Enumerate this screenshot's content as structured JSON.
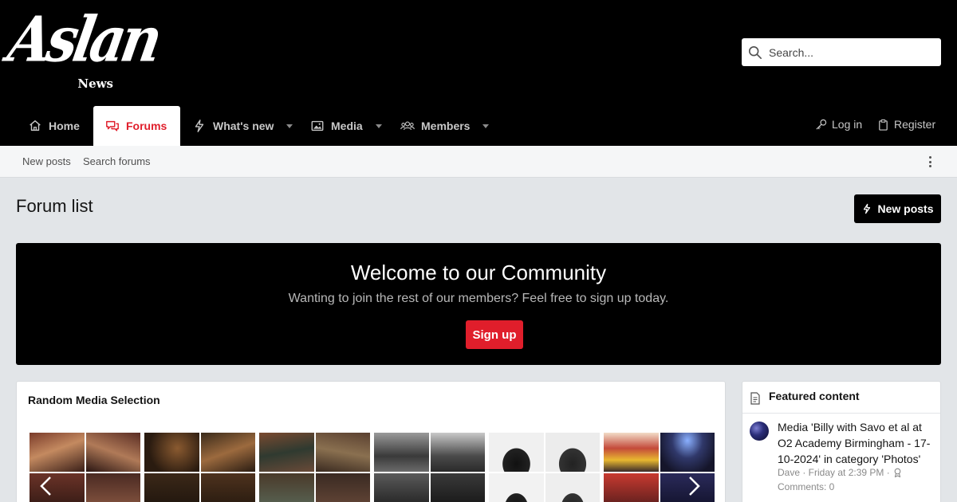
{
  "logo": {
    "script": "Aslan",
    "sub": "News"
  },
  "search": {
    "placeholder": "Search..."
  },
  "nav": {
    "tabs": [
      {
        "label": "Home",
        "icon": "home-icon"
      },
      {
        "label": "Forums",
        "icon": "chat-icon",
        "active": true
      },
      {
        "label": "What's new",
        "icon": "bolt-icon",
        "dropdown": true
      },
      {
        "label": "Media",
        "icon": "image-icon",
        "dropdown": true
      },
      {
        "label": "Members",
        "icon": "users-icon",
        "dropdown": true
      }
    ],
    "login": "Log in",
    "register": "Register"
  },
  "subnav": {
    "items": [
      "New posts",
      "Search forums"
    ]
  },
  "page": {
    "title": "Forum list",
    "new_posts_button": "New posts"
  },
  "welcome": {
    "title": "Welcome to our Community",
    "text": "Wanting to join the rest of our members? Feel free to sign up today.",
    "button": "Sign up"
  },
  "media": {
    "title": "Random Media Selection"
  },
  "featured": {
    "title": "Featured content",
    "item": {
      "text": "Media 'Billy with Savo et al at O2 Academy Birmingham - 17-10-2024' in category 'Photos'",
      "meta": "Dave · Friday at 2:39 PM ·",
      "comments": "Comments: 0"
    }
  },
  "colors": {
    "accent": "#e01e2b",
    "header": "#000000",
    "page_bg": "#e2e5e8"
  }
}
